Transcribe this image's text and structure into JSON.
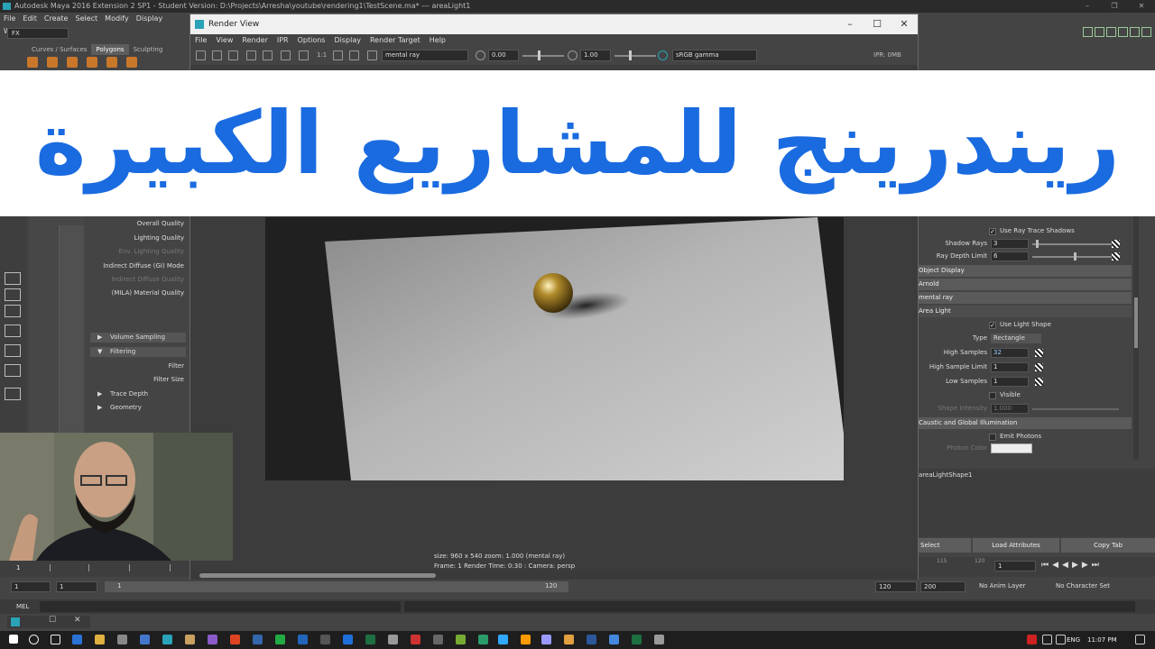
{
  "maya": {
    "title": "Autodesk Maya 2016 Extension 2 SP1 - Student Version: D:\\Projects\\Arresha\\youtube\\rendering1\\TestScene.ma*   ---   areaLight1",
    "menu": [
      "File",
      "Edit",
      "Create",
      "Select",
      "Modify",
      "Display",
      "Window"
    ],
    "mode": "FX",
    "shelf_tabs": [
      "Curves / Surfaces",
      "Polygons",
      "Sculpting"
    ],
    "shelf_active": "Polygons"
  },
  "render_view": {
    "title": "Render View",
    "menu": [
      "File",
      "View",
      "Render",
      "IPR",
      "Options",
      "Display",
      "Render Target",
      "Help"
    ],
    "ratio": "1:1",
    "renderer": "mental ray",
    "exposure": "0.00",
    "gamma": "1.00",
    "color_space": "sRGB gamma",
    "ipr": "IPR: 0MB",
    "status_line1": "size: 960 x 540  zoom: 1.000        (mental ray)",
    "status_line2": "Frame: 1        Render Time: 0:30 :   Camera: persp"
  },
  "quality_panel": {
    "items": [
      {
        "label": "Overall Quality",
        "dim": false
      },
      {
        "label": "Lighting Quality",
        "dim": false
      },
      {
        "label": "Env. Lighting Quality",
        "dim": true
      },
      {
        "label": "Indirect Diffuse (GI) Mode",
        "dim": false
      },
      {
        "label": "Indirect Diffuse Quality",
        "dim": true
      },
      {
        "label": "(MILA) Material Quality",
        "dim": false
      }
    ],
    "sections": [
      "Volume Sampling",
      "Filtering",
      "Trace Depth",
      "Geometry"
    ],
    "filter_labels": [
      "Filter",
      "Filter Size"
    ]
  },
  "attr_editor": {
    "use_ray_trace_shadows": "Use Ray Trace Shadows",
    "shadow_rays_label": "Shadow Rays",
    "shadow_rays": "3",
    "ray_depth_label": "Ray Depth Limit",
    "ray_depth": "6",
    "sections": [
      "Object Display",
      "Arnold",
      "mental ray",
      "Area Light"
    ],
    "use_light_shape": "Use Light Shape",
    "type_label": "Type",
    "type_value": "Rectangle",
    "high_samples_label": "High Samples",
    "high_samples": "32",
    "high_sample_limit_label": "High Sample Limit",
    "high_sample_limit": "1",
    "low_samples_label": "Low Samples",
    "low_samples": "1",
    "visible": "Visible",
    "shape_intensity_label": "Shape Intensity",
    "shape_intensity": "1.000",
    "caustic_section": "Caustic and Global Illumination",
    "emit_photons": "Emit Photons",
    "photon_color_label": "Photon Color",
    "node_name": "areaLightShape1",
    "buttons": [
      "Select",
      "Load Attributes",
      "Copy Tab"
    ]
  },
  "timeline": {
    "start": "1",
    "range_start": "1",
    "range_start2": "1",
    "range_marker": "120",
    "range_end": "120",
    "range_max": "200",
    "current": "1",
    "tick_115": "115",
    "tick_120": "120",
    "anim_layer": "No Anim Layer",
    "char_set": "No Character Set"
  },
  "mel": {
    "label": "MEL"
  },
  "taskbar": {
    "lang": "ENG",
    "time": "11:07 PM"
  },
  "banner": {
    "text": "ريندرينج للمشاريع الكبيرة",
    "color": "#1a6be0"
  }
}
